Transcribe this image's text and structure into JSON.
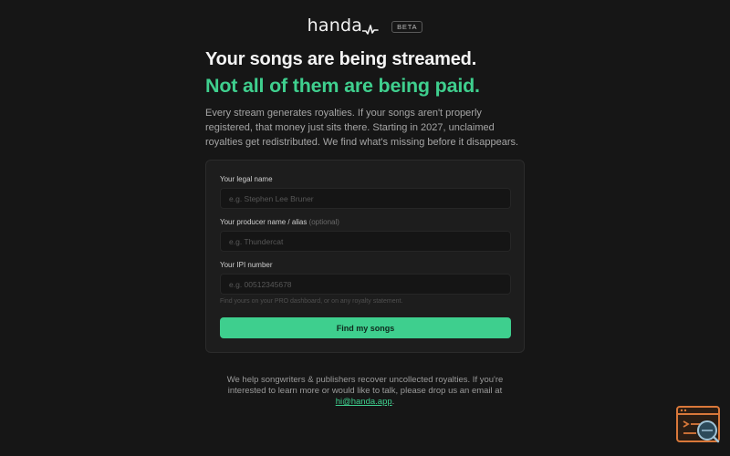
{
  "header": {
    "logo_text": "handa",
    "badge": "BETA"
  },
  "hero": {
    "headline": "Your songs are being streamed.",
    "subheadline": "Not all of them are being paid.",
    "intro": "Every stream generates royalties. If your songs aren't properly registered, that money just sits there. Starting in 2027, unclaimed royalties get redistributed. We find what's missing before it disappears."
  },
  "form": {
    "legal_name": {
      "label": "Your legal name",
      "placeholder": "e.g. Stephen Lee Bruner",
      "value": ""
    },
    "producer_name": {
      "label": "Your producer name / alias",
      "optional": "(optional)",
      "placeholder": "e.g. Thundercat",
      "value": ""
    },
    "ipi_number": {
      "label": "Your IPI number",
      "placeholder": "e.g. 00512345678",
      "value": ""
    },
    "hint": "Find yours on your PRO dashboard, or on any royalty statement.",
    "submit_label": "Find my songs"
  },
  "footer": {
    "text_before": "We help songwriters & publishers recover uncollected royalties. If you're interested to learn more or would like to talk, please drop us an email at",
    "email": "hi@handa.app",
    "text_after": "."
  },
  "colors": {
    "background": "#161616",
    "accent": "#3ecf8e",
    "card": "#1d1d1d"
  },
  "icons": {
    "logo_mark": "waveform-icon",
    "corner_widget": "console-search-icon"
  }
}
